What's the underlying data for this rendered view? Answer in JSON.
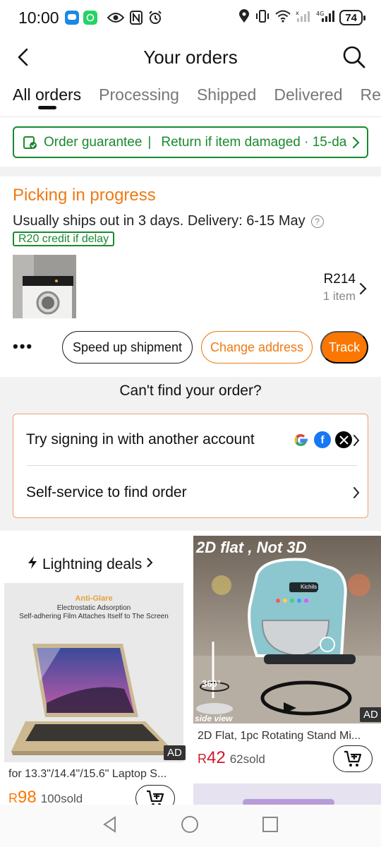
{
  "status_bar": {
    "time": "10:00",
    "battery": "74"
  },
  "header": {
    "title": "Your orders"
  },
  "tabs": [
    {
      "label": "All orders"
    },
    {
      "label": "Processing"
    },
    {
      "label": "Shipped"
    },
    {
      "label": "Delivered"
    },
    {
      "label": "Ret"
    }
  ],
  "guarantee": {
    "label": "Order guarantee",
    "separator": "|",
    "text": "Return if item damaged · 15-da"
  },
  "order": {
    "status": "Picking in progress",
    "ship_info": "Usually ships out in 3 days. Delivery: 6-15 May",
    "credit_badge": "R20 credit if delay",
    "price": "R214",
    "item_count": "1 item",
    "more": "•••",
    "buttons": {
      "speed_up": "Speed up shipment",
      "change_address": "Change address",
      "track": "Track"
    }
  },
  "cant_find": {
    "title": "Can't find your order?",
    "sign_in": "Try signing in with another account",
    "self_service": "Self-service to find order"
  },
  "products": {
    "lightning_title": "Lightning deals",
    "p1": {
      "img_line1": "Anti-Glare",
      "img_line2": "Electrostatic Adsorption",
      "img_line3": "Self-adhering Film Attaches Itself to The Screen",
      "ad": "AD",
      "name": "for 13.3\"/14.4\"/15.6\" Laptop S...",
      "currency": "R",
      "price": "98",
      "sold": "100sold"
    },
    "p2": {
      "img_caption": "2D flat , Not 3D",
      "img_badge": "360°",
      "img_side": "side view",
      "brand": "Kichils",
      "ad": "AD",
      "name": "2D Flat, 1pc Rotating Stand Mi...",
      "currency": "R",
      "price": "42",
      "sold": "62sold"
    }
  },
  "colors": {
    "accent_orange": "#fb7701",
    "status_orange": "#ee7a14",
    "guarantee_green": "#1a8a2f"
  }
}
